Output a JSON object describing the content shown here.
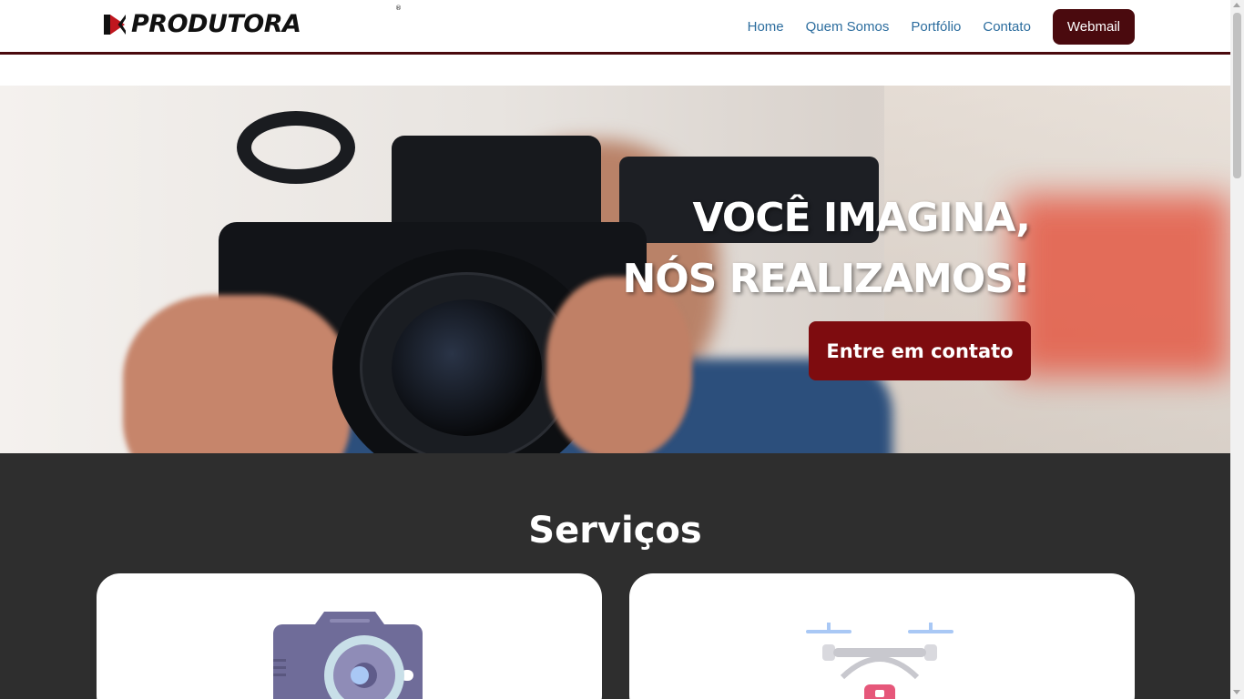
{
  "header": {
    "logo_text": "PRODUTORA",
    "logo_reg": "®",
    "nav": {
      "home": "Home",
      "about": "Quem Somos",
      "portfolio": "Portfólio",
      "contact": "Contato",
      "webmail": "Webmail"
    }
  },
  "hero": {
    "title_line1": "VOCÊ IMAGINA,",
    "title_line2": "NÓS REALIZAMOS!",
    "cta": "Entre em contato"
  },
  "services": {
    "title": "Serviços",
    "cards": [
      {
        "icon": "camera-icon"
      },
      {
        "icon": "drone-icon"
      }
    ]
  },
  "colors": {
    "brand_dark": "#4a0a0e",
    "cta": "#7e0c0f",
    "nav_link": "#2c6d9e",
    "services_bg": "#2e2e2e"
  }
}
